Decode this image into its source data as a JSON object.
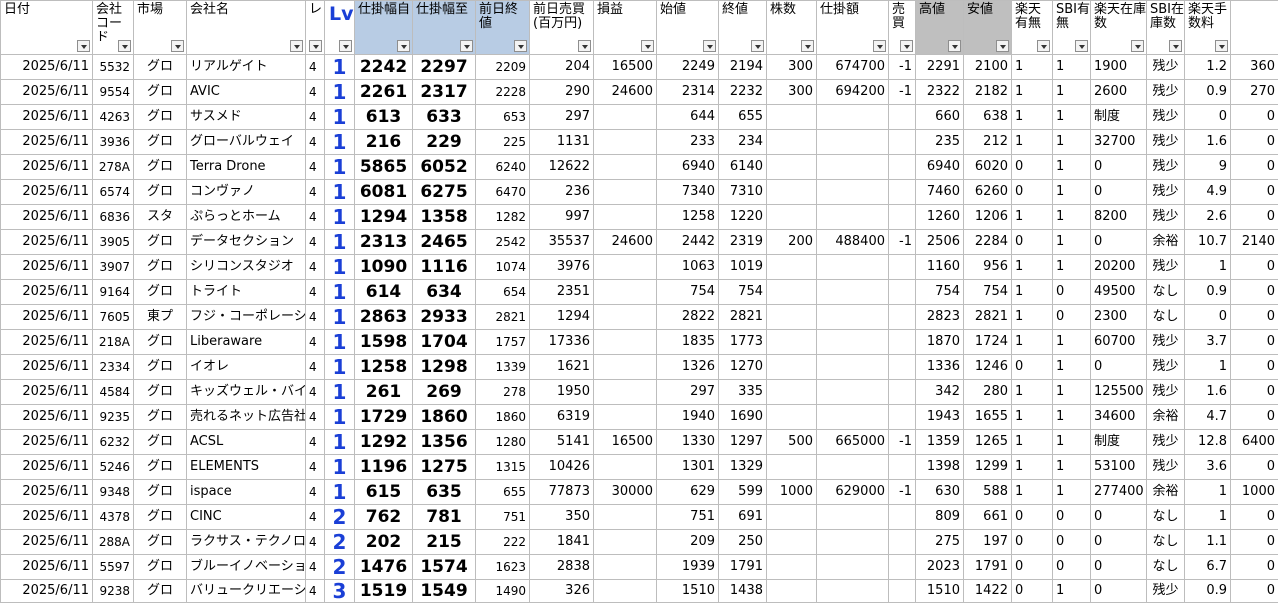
{
  "headers": [
    {
      "key": "date",
      "label": "日付"
    },
    {
      "key": "code",
      "label": "会社コード"
    },
    {
      "key": "market",
      "label": "市場"
    },
    {
      "key": "name",
      "label": "会社名"
    },
    {
      "key": "level",
      "label": "レ"
    },
    {
      "key": "lv",
      "label": "Lv"
    },
    {
      "key": "order_from",
      "label": "仕掛幅自"
    },
    {
      "key": "order_to",
      "label": "仕掛幅至"
    },
    {
      "key": "prev_close",
      "label": "前日終値"
    },
    {
      "key": "prev_volume",
      "label": "前日売買(百万円)"
    },
    {
      "key": "pnl",
      "label": "損益"
    },
    {
      "key": "open",
      "label": "始値"
    },
    {
      "key": "close",
      "label": "終値"
    },
    {
      "key": "shares",
      "label": "株数"
    },
    {
      "key": "amount",
      "label": "仕掛額"
    },
    {
      "key": "side",
      "label": "売買"
    },
    {
      "key": "high",
      "label": "高値"
    },
    {
      "key": "low",
      "label": "安値"
    },
    {
      "key": "rakuten_avail",
      "label": "楽天有無"
    },
    {
      "key": "sbi_avail",
      "label": "SBI有無"
    },
    {
      "key": "rakuten_stock",
      "label": "楽天在庫数"
    },
    {
      "key": "sbi_stock",
      "label": "SBI在庫数"
    },
    {
      "key": "fee_rate",
      "label": "楽天手数料"
    },
    {
      "key": "fee",
      "label": ""
    }
  ],
  "rows": [
    {
      "date": "2025/6/11",
      "code": "5532",
      "market": "グロ",
      "name": "リアルゲイト",
      "level": "4",
      "lv": "1",
      "order_from": "2242",
      "order_to": "2297",
      "prev_close": "2209",
      "prev_volume": "204",
      "pnl": "16500",
      "open": "2249",
      "close": "2194",
      "shares": "300",
      "amount": "674700",
      "side": "-1",
      "high": "2291",
      "low": "2100",
      "rakuten_avail": "1",
      "sbi_avail": "1",
      "rakuten_stock": "1900",
      "sbi_stock": "残少",
      "fee_rate": "1.2",
      "fee": "360"
    },
    {
      "date": "2025/6/11",
      "code": "9554",
      "market": "グロ",
      "name": "AVIC",
      "level": "4",
      "lv": "1",
      "order_from": "2261",
      "order_to": "2317",
      "prev_close": "2228",
      "prev_volume": "290",
      "pnl": "24600",
      "open": "2314",
      "close": "2232",
      "shares": "300",
      "amount": "694200",
      "side": "-1",
      "high": "2322",
      "low": "2182",
      "rakuten_avail": "1",
      "sbi_avail": "1",
      "rakuten_stock": "2600",
      "sbi_stock": "残少",
      "fee_rate": "0.9",
      "fee": "270"
    },
    {
      "date": "2025/6/11",
      "code": "4263",
      "market": "グロ",
      "name": "サスメド",
      "level": "4",
      "lv": "1",
      "order_from": "613",
      "order_to": "633",
      "prev_close": "653",
      "prev_volume": "297",
      "pnl": "",
      "open": "644",
      "close": "655",
      "shares": "",
      "amount": "",
      "side": "",
      "high": "660",
      "low": "638",
      "rakuten_avail": "1",
      "sbi_avail": "1",
      "rakuten_stock": "制度",
      "sbi_stock": "残少",
      "fee_rate": "0",
      "fee": "0"
    },
    {
      "date": "2025/6/11",
      "code": "3936",
      "market": "グロ",
      "name": "グローバルウェイ",
      "level": "4",
      "lv": "1",
      "order_from": "216",
      "order_to": "229",
      "prev_close": "225",
      "prev_volume": "1131",
      "pnl": "",
      "open": "233",
      "close": "234",
      "shares": "",
      "amount": "",
      "side": "",
      "high": "235",
      "low": "212",
      "rakuten_avail": "1",
      "sbi_avail": "1",
      "rakuten_stock": "32700",
      "sbi_stock": "残少",
      "fee_rate": "1.6",
      "fee": "0"
    },
    {
      "date": "2025/6/11",
      "code": "278A",
      "market": "グロ",
      "name": "Terra Drone",
      "level": "4",
      "lv": "1",
      "order_from": "5865",
      "order_to": "6052",
      "prev_close": "6240",
      "prev_volume": "12622",
      "pnl": "",
      "open": "6940",
      "close": "6140",
      "shares": "",
      "amount": "",
      "side": "",
      "high": "6940",
      "low": "6020",
      "rakuten_avail": "0",
      "sbi_avail": "1",
      "rakuten_stock": "0",
      "sbi_stock": "残少",
      "fee_rate": "9",
      "fee": "0"
    },
    {
      "date": "2025/6/11",
      "code": "6574",
      "market": "グロ",
      "name": "コンヴァノ",
      "level": "4",
      "lv": "1",
      "order_from": "6081",
      "order_to": "6275",
      "prev_close": "6470",
      "prev_volume": "236",
      "pnl": "",
      "open": "7340",
      "close": "7310",
      "shares": "",
      "amount": "",
      "side": "",
      "high": "7460",
      "low": "6260",
      "rakuten_avail": "0",
      "sbi_avail": "1",
      "rakuten_stock": "0",
      "sbi_stock": "残少",
      "fee_rate": "4.9",
      "fee": "0"
    },
    {
      "date": "2025/6/11",
      "code": "6836",
      "market": "スタ",
      "name": "ぷらっとホーム",
      "level": "4",
      "lv": "1",
      "order_from": "1294",
      "order_to": "1358",
      "prev_close": "1282",
      "prev_volume": "997",
      "pnl": "",
      "open": "1258",
      "close": "1220",
      "shares": "",
      "amount": "",
      "side": "",
      "high": "1260",
      "low": "1206",
      "rakuten_avail": "1",
      "sbi_avail": "1",
      "rakuten_stock": "8200",
      "sbi_stock": "残少",
      "fee_rate": "2.6",
      "fee": "0"
    },
    {
      "date": "2025/6/11",
      "code": "3905",
      "market": "グロ",
      "name": "データセクション",
      "level": "4",
      "lv": "1",
      "order_from": "2313",
      "order_to": "2465",
      "prev_close": "2542",
      "prev_volume": "35537",
      "pnl": "24600",
      "open": "2442",
      "close": "2319",
      "shares": "200",
      "amount": "488400",
      "side": "-1",
      "high": "2506",
      "low": "2284",
      "rakuten_avail": "0",
      "sbi_avail": "1",
      "rakuten_stock": "0",
      "sbi_stock": "余裕",
      "fee_rate": "10.7",
      "fee": "2140"
    },
    {
      "date": "2025/6/11",
      "code": "3907",
      "market": "グロ",
      "name": "シリコンスタジオ",
      "level": "4",
      "lv": "1",
      "order_from": "1090",
      "order_to": "1116",
      "prev_close": "1074",
      "prev_volume": "3976",
      "pnl": "",
      "open": "1063",
      "close": "1019",
      "shares": "",
      "amount": "",
      "side": "",
      "high": "1160",
      "low": "956",
      "rakuten_avail": "1",
      "sbi_avail": "1",
      "rakuten_stock": "20200",
      "sbi_stock": "残少",
      "fee_rate": "1",
      "fee": "0"
    },
    {
      "date": "2025/6/11",
      "code": "9164",
      "market": "グロ",
      "name": "トライト",
      "level": "4",
      "lv": "1",
      "order_from": "614",
      "order_to": "634",
      "prev_close": "654",
      "prev_volume": "2351",
      "pnl": "",
      "open": "754",
      "close": "754",
      "shares": "",
      "amount": "",
      "side": "",
      "high": "754",
      "low": "754",
      "rakuten_avail": "1",
      "sbi_avail": "0",
      "rakuten_stock": "49500",
      "sbi_stock": "なし",
      "fee_rate": "0.9",
      "fee": "0"
    },
    {
      "date": "2025/6/11",
      "code": "7605",
      "market": "東プ",
      "name": "フジ・コーポレーション",
      "level": "4",
      "lv": "1",
      "order_from": "2863",
      "order_to": "2933",
      "prev_close": "2821",
      "prev_volume": "1294",
      "pnl": "",
      "open": "2822",
      "close": "2821",
      "shares": "",
      "amount": "",
      "side": "",
      "high": "2823",
      "low": "2821",
      "rakuten_avail": "1",
      "sbi_avail": "0",
      "rakuten_stock": "2300",
      "sbi_stock": "なし",
      "fee_rate": "0",
      "fee": "0"
    },
    {
      "date": "2025/6/11",
      "code": "218A",
      "market": "グロ",
      "name": "Liberaware",
      "level": "4",
      "lv": "1",
      "order_from": "1598",
      "order_to": "1704",
      "prev_close": "1757",
      "prev_volume": "17336",
      "pnl": "",
      "open": "1835",
      "close": "1773",
      "shares": "",
      "amount": "",
      "side": "",
      "high": "1870",
      "low": "1724",
      "rakuten_avail": "1",
      "sbi_avail": "1",
      "rakuten_stock": "60700",
      "sbi_stock": "残少",
      "fee_rate": "3.7",
      "fee": "0"
    },
    {
      "date": "2025/6/11",
      "code": "2334",
      "market": "グロ",
      "name": "イオレ",
      "level": "4",
      "lv": "1",
      "order_from": "1258",
      "order_to": "1298",
      "prev_close": "1339",
      "prev_volume": "1621",
      "pnl": "",
      "open": "1326",
      "close": "1270",
      "shares": "",
      "amount": "",
      "side": "",
      "high": "1336",
      "low": "1246",
      "rakuten_avail": "0",
      "sbi_avail": "1",
      "rakuten_stock": "0",
      "sbi_stock": "残少",
      "fee_rate": "1",
      "fee": "0"
    },
    {
      "date": "2025/6/11",
      "code": "4584",
      "market": "グロ",
      "name": "キッズウェル・バイオ",
      "level": "4",
      "lv": "1",
      "order_from": "261",
      "order_to": "269",
      "prev_close": "278",
      "prev_volume": "1950",
      "pnl": "",
      "open": "297",
      "close": "335",
      "shares": "",
      "amount": "",
      "side": "",
      "high": "342",
      "low": "280",
      "rakuten_avail": "1",
      "sbi_avail": "1",
      "rakuten_stock": "125500",
      "sbi_stock": "残少",
      "fee_rate": "1.6",
      "fee": "0"
    },
    {
      "date": "2025/6/11",
      "code": "9235",
      "market": "グロ",
      "name": "売れるネット広告社",
      "level": "4",
      "lv": "1",
      "order_from": "1729",
      "order_to": "1860",
      "prev_close": "1860",
      "prev_volume": "6319",
      "pnl": "",
      "open": "1940",
      "close": "1690",
      "shares": "",
      "amount": "",
      "side": "",
      "high": "1943",
      "low": "1655",
      "rakuten_avail": "1",
      "sbi_avail": "1",
      "rakuten_stock": "34600",
      "sbi_stock": "余裕",
      "fee_rate": "4.7",
      "fee": "0"
    },
    {
      "date": "2025/6/11",
      "code": "6232",
      "market": "グロ",
      "name": "ACSL",
      "level": "4",
      "lv": "1",
      "order_from": "1292",
      "order_to": "1356",
      "prev_close": "1280",
      "prev_volume": "5141",
      "pnl": "16500",
      "open": "1330",
      "close": "1297",
      "shares": "500",
      "amount": "665000",
      "side": "-1",
      "high": "1359",
      "low": "1265",
      "rakuten_avail": "1",
      "sbi_avail": "1",
      "rakuten_stock": "制度",
      "sbi_stock": "残少",
      "fee_rate": "12.8",
      "fee": "6400"
    },
    {
      "date": "2025/6/11",
      "code": "5246",
      "market": "グロ",
      "name": "ELEMENTS",
      "level": "4",
      "lv": "1",
      "order_from": "1196",
      "order_to": "1275",
      "prev_close": "1315",
      "prev_volume": "10426",
      "pnl": "",
      "open": "1301",
      "close": "1329",
      "shares": "",
      "amount": "",
      "side": "",
      "high": "1398",
      "low": "1299",
      "rakuten_avail": "1",
      "sbi_avail": "1",
      "rakuten_stock": "53100",
      "sbi_stock": "残少",
      "fee_rate": "3.6",
      "fee": "0"
    },
    {
      "date": "2025/6/11",
      "code": "9348",
      "market": "グロ",
      "name": "ispace",
      "level": "4",
      "lv": "1",
      "order_from": "615",
      "order_to": "635",
      "prev_close": "655",
      "prev_volume": "77873",
      "pnl": "30000",
      "open": "629",
      "close": "599",
      "shares": "1000",
      "amount": "629000",
      "side": "-1",
      "high": "630",
      "low": "588",
      "rakuten_avail": "1",
      "sbi_avail": "1",
      "rakuten_stock": "277400",
      "sbi_stock": "余裕",
      "fee_rate": "1",
      "fee": "1000"
    },
    {
      "date": "2025/6/11",
      "code": "4378",
      "market": "グロ",
      "name": "CINC",
      "level": "4",
      "lv": "2",
      "order_from": "762",
      "order_to": "781",
      "prev_close": "751",
      "prev_volume": "350",
      "pnl": "",
      "open": "751",
      "close": "691",
      "shares": "",
      "amount": "",
      "side": "",
      "high": "809",
      "low": "661",
      "rakuten_avail": "0",
      "sbi_avail": "0",
      "rakuten_stock": "0",
      "sbi_stock": "なし",
      "fee_rate": "1",
      "fee": "0"
    },
    {
      "date": "2025/6/11",
      "code": "288A",
      "market": "グロ",
      "name": "ラクサス・テクノロジーズ",
      "level": "4",
      "lv": "2",
      "order_from": "202",
      "order_to": "215",
      "prev_close": "222",
      "prev_volume": "1841",
      "pnl": "",
      "open": "209",
      "close": "250",
      "shares": "",
      "amount": "",
      "side": "",
      "high": "275",
      "low": "197",
      "rakuten_avail": "0",
      "sbi_avail": "0",
      "rakuten_stock": "0",
      "sbi_stock": "なし",
      "fee_rate": "1.1",
      "fee": "0"
    },
    {
      "date": "2025/6/11",
      "code": "5597",
      "market": "グロ",
      "name": "ブルーイノベーション",
      "level": "4",
      "lv": "2",
      "order_from": "1476",
      "order_to": "1574",
      "prev_close": "1623",
      "prev_volume": "2838",
      "pnl": "",
      "open": "1939",
      "close": "1791",
      "shares": "",
      "amount": "",
      "side": "",
      "high": "2023",
      "low": "1791",
      "rakuten_avail": "0",
      "sbi_avail": "0",
      "rakuten_stock": "0",
      "sbi_stock": "なし",
      "fee_rate": "6.7",
      "fee": "0"
    },
    {
      "date": "2025/6/11",
      "code": "9238",
      "market": "グロ",
      "name": "バリュークリエーション",
      "level": "4",
      "lv": "3",
      "order_from": "1519",
      "order_to": "1549",
      "prev_close": "1490",
      "prev_volume": "326",
      "pnl": "",
      "open": "1510",
      "close": "1438",
      "shares": "",
      "amount": "",
      "side": "",
      "high": "1510",
      "low": "1422",
      "rakuten_avail": "0",
      "sbi_avail": "1",
      "rakuten_stock": "0",
      "sbi_stock": "残少",
      "fee_rate": "0.9",
      "fee": "0"
    }
  ]
}
